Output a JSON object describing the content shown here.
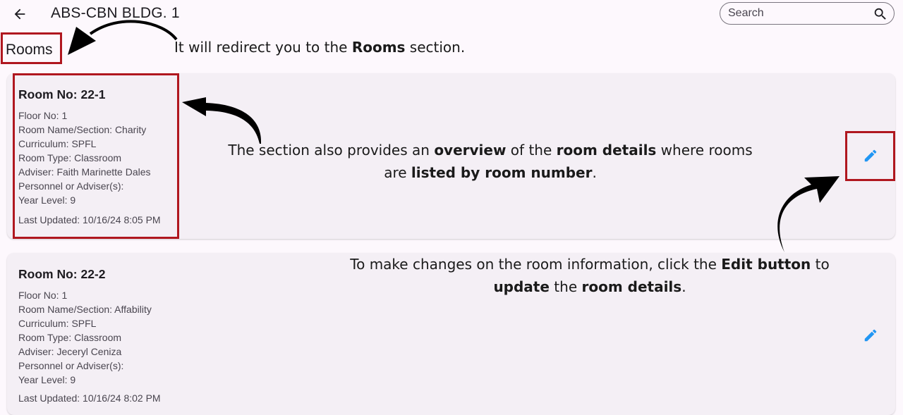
{
  "header": {
    "title": "ABS-CBN BLDG. 1",
    "search_placeholder": "Search",
    "back_icon": "arrow-left-icon",
    "search_icon": "magnifier-icon"
  },
  "section": {
    "heading": "Rooms"
  },
  "rooms": [
    {
      "room_no": "Room No: 22-1",
      "floor": "Floor No: 1",
      "name_section": "Room Name/Section: Charity",
      "curriculum": "Curriculum: SPFL",
      "room_type": "Room Type: Classroom",
      "adviser": "Adviser: Faith Marinette Dales",
      "personnel": "Personnel or Adviser(s):",
      "year_level": "Year Level: 9",
      "last_updated": "Last Updated: 10/16/24 8:05 PM"
    },
    {
      "room_no": "Room No: 22-2",
      "floor": "Floor No: 1",
      "name_section": "Room Name/Section: Affability",
      "curriculum": "Curriculum: SPFL",
      "room_type": "Room Type: Classroom",
      "adviser": "Adviser: Jeceryl Ceniza",
      "personnel": "Personnel or Adviser(s):",
      "year_level": "Year Level: 9",
      "last_updated": "Last Updated: 10/16/24 8:02 PM"
    }
  ],
  "annotations": {
    "rooms_callout": {
      "pre": "It will redirect you to the ",
      "bold": "Rooms",
      "post": " section."
    },
    "overview_callout": {
      "line1_pre": "The section also provides an ",
      "line1_bold1": "overview",
      "line1_mid": " of the ",
      "line1_bold2": "room details",
      "line1_post": " where rooms",
      "line2_pre": "are ",
      "line2_bold": "listed by room number",
      "line2_post": "."
    },
    "edit_callout": {
      "line1_pre": "To make changes on the room information, click the ",
      "line1_bold": "Edit button",
      "line1_post": " to",
      "line2_bold1": "update",
      "line2_mid": " the ",
      "line2_bold2": "room details",
      "line2_post": "."
    }
  },
  "colors": {
    "background": "#fdf8fd",
    "card": "#f4eff5",
    "highlight": "#b0171f",
    "edit_icon": "#2196f3",
    "arrow": "#000000"
  }
}
